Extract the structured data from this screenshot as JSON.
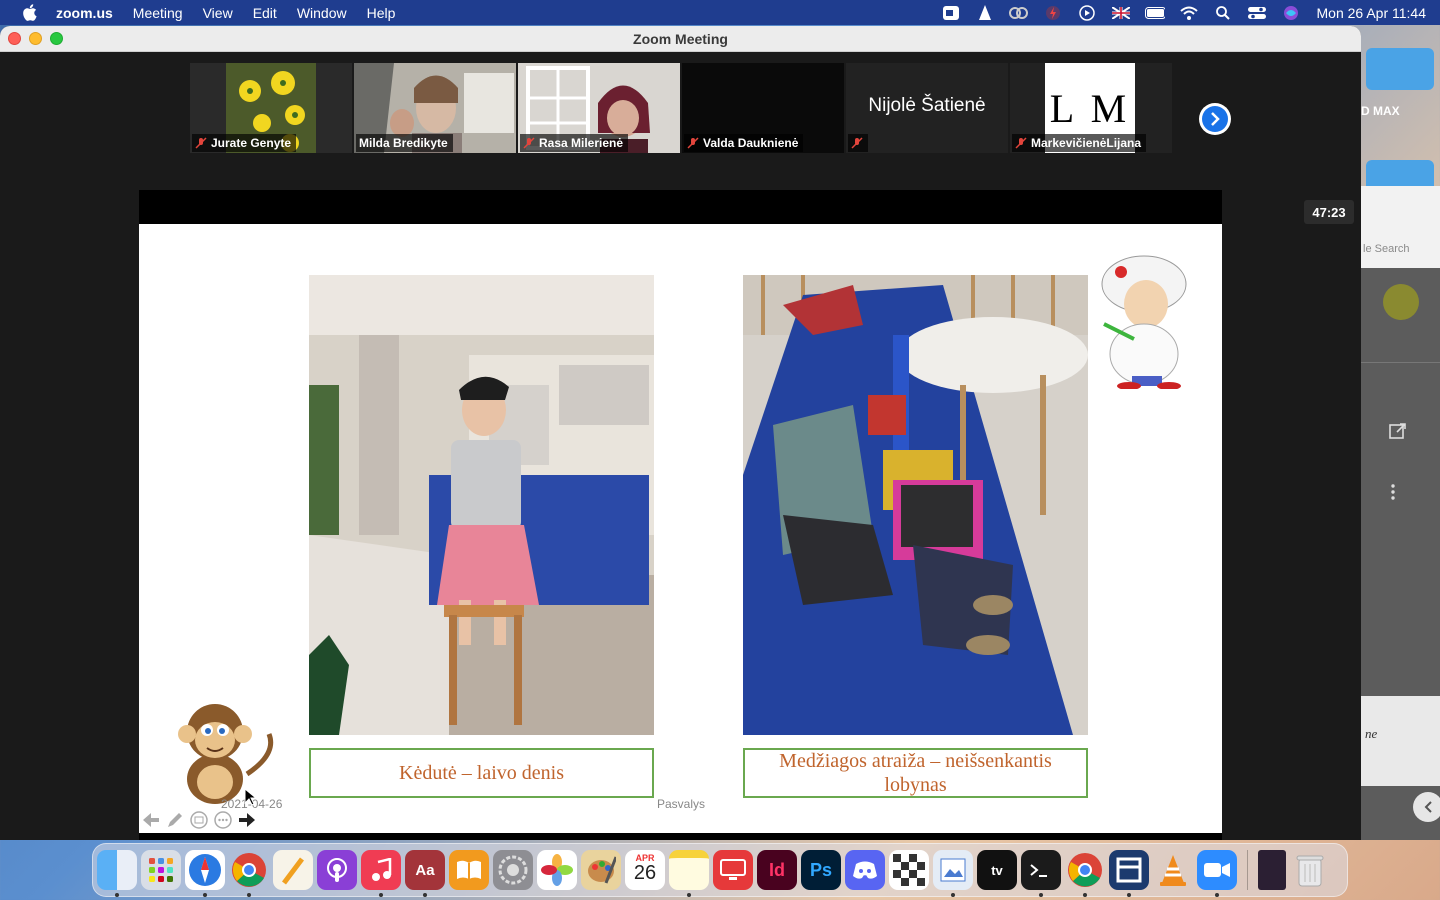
{
  "menubar": {
    "app_name": "zoom.us",
    "items": [
      "Meeting",
      "View",
      "Edit",
      "Window",
      "Help"
    ],
    "clock": "Mon 26 Apr  11:44"
  },
  "window": {
    "title": "Zoom Meeting"
  },
  "participants": [
    {
      "name": "Jurate Genyte",
      "muted": true
    },
    {
      "name": "Milda Bredikyte",
      "active": true
    },
    {
      "name": "Rasa Milerienė",
      "muted": true
    },
    {
      "name": "Valda Dauknienė",
      "muted": true
    },
    {
      "name": "",
      "display_name": "Nijolė Šatienė",
      "muted": true
    },
    {
      "name": "MarkevičienėLijana",
      "avatar_text": "L M",
      "muted": true
    }
  ],
  "timer": "47:23",
  "slide": {
    "caption_left": "Kėdutė – laivo denis",
    "caption_right": "Medžiagos atraiža – neišsenkantis lobynas",
    "date": "2021-04-26",
    "footer": "Pasvalys"
  },
  "background": {
    "desktop_label": "D MAX",
    "search_placeholder": "le Search",
    "italic_text": "ne"
  },
  "dock": {
    "calendar_month": "APR",
    "calendar_day": "26",
    "apps": [
      "finder",
      "launchpad",
      "safari",
      "chrome",
      "pages",
      "podcasts",
      "music",
      "dictionary",
      "books",
      "system-preferences",
      "photos",
      "paint",
      "calendar",
      "notes",
      "screen-sharing",
      "indesign",
      "photoshop",
      "discord",
      "chess",
      "preview",
      "apple-tv",
      "terminal",
      "chrome-2",
      "window-manager",
      "vlc",
      "zoom",
      "book-cover",
      "trash"
    ]
  },
  "colors": {
    "menubar": "#1f3d8f",
    "caption_border": "#6aa84f",
    "caption_text": "#c0642d",
    "active_tile": "#d6e02c"
  }
}
